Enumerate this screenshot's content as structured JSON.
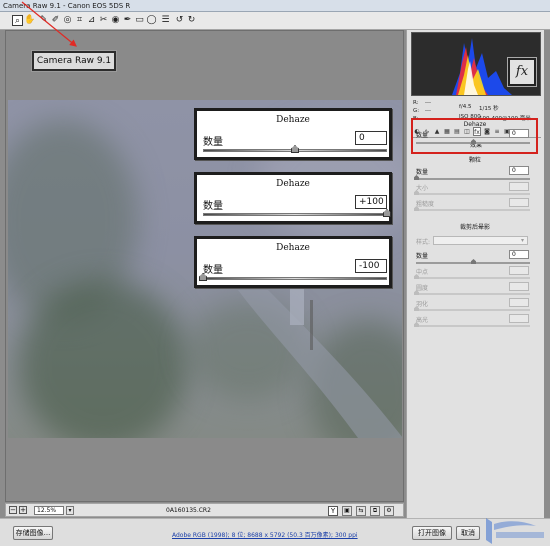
{
  "window": {
    "title": "Camera Raw 9.1 -  Canon EOS 5DS R"
  },
  "toolbar": {
    "tools": [
      {
        "icon": "zoom-icon",
        "glyph": "⌕"
      },
      {
        "icon": "hand-icon",
        "glyph": "✋"
      },
      {
        "icon": "white-balance-icon",
        "glyph": "✎"
      },
      {
        "icon": "color-sampler-icon",
        "glyph": "✐"
      },
      {
        "icon": "targeted-adjustment-icon",
        "glyph": "◎"
      },
      {
        "icon": "crop-icon",
        "glyph": "⌗"
      },
      {
        "icon": "straighten-icon",
        "glyph": "⊿"
      },
      {
        "icon": "spot-removal-icon",
        "glyph": "✂"
      },
      {
        "icon": "red-eye-icon",
        "glyph": "◉"
      },
      {
        "icon": "adjustment-brush-icon",
        "glyph": "✒"
      },
      {
        "icon": "graduated-filter-icon",
        "glyph": "▭"
      },
      {
        "icon": "radial-filter-icon",
        "glyph": "◯"
      },
      {
        "icon": "preferences-icon",
        "glyph": "☰"
      },
      {
        "icon": "rotate-left-icon",
        "glyph": "↺"
      },
      {
        "icon": "rotate-right-icon",
        "glyph": "↻"
      }
    ]
  },
  "badge": {
    "label": "Camera Raw 9.1"
  },
  "dehaze_panels": [
    {
      "title": "Dehaze",
      "label": "数量",
      "value": "0",
      "level": 0
    },
    {
      "title": "Dehaze",
      "label": "数量",
      "value": "+100",
      "level": 100
    },
    {
      "title": "Dehaze",
      "label": "数量",
      "value": "-100",
      "level": -100
    }
  ],
  "camera_info": {
    "r": "R:",
    "g": "G:",
    "b": "B:",
    "r_value": "---",
    "g_value": "---",
    "b_value": "---",
    "aperture": "f/4.5",
    "shutter": "1/15 秒",
    "iso": "ISO 800",
    "lens": "100-400@100 毫米"
  },
  "fx_icon": {
    "label": "fx"
  },
  "right_panel": {
    "section_effects": "效果",
    "dehaze_section": "Dehaze",
    "dehaze_amount_label": "数量",
    "dehaze_amount_value": "0",
    "grain_section": "颗粒",
    "grain_amount_label": "数量",
    "grain_amount_value": "0",
    "grain_size_label": "大小",
    "grain_roughness_label": "粗糙度",
    "vignette_section": "裁剪后晕影",
    "style_label": "样式:",
    "vignette_amount_label": "数量",
    "vignette_amount_value": "0",
    "midpoint_label": "中点",
    "roundness_label": "圆度",
    "feather_label": "羽化",
    "highlights_label": "高光"
  },
  "statusbar": {
    "zoom_value": "12.5%",
    "filename": "0A160135.CR2"
  },
  "footer": {
    "save_label": "存储图像...",
    "workflow_link": "Adobe RGB (1998); 8 位; 8688 x 5792 (50.3 百万像素); 300 ppi",
    "open_label": "打开图像",
    "cancel_label": "取消"
  },
  "colors": {
    "highlight": "#d4221d",
    "arrow": "#e02a24"
  }
}
